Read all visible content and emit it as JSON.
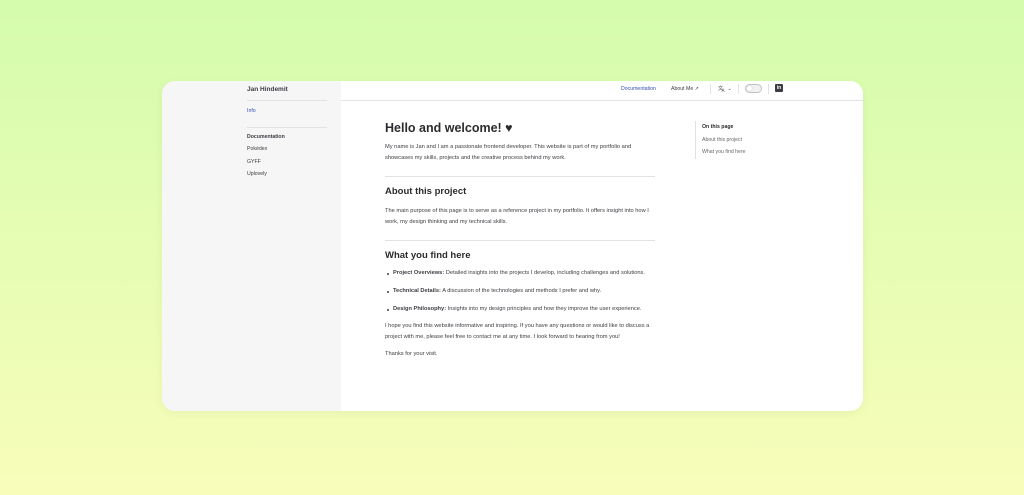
{
  "site": {
    "title": "Jan Hindemit"
  },
  "sidebar": {
    "top_link": "Info",
    "section_heading": "Documentation",
    "items": [
      "Pokédex",
      "GYFF",
      "Uplovely"
    ]
  },
  "nav": {
    "documentation": "Documentation",
    "about": "About Me ↗",
    "language_icon": "translate-icon",
    "chevron": "⌄",
    "social": "in"
  },
  "main": {
    "title": "Hello and welcome! ♥",
    "intro": "My name is Jan and I am a passionate frontend developer. This website is part of my portfolio and showcases my skills, projects and the creative process behind my work.",
    "about_heading": "About this project",
    "about_text": "The main purpose of this page is to serve as a reference project in my portfolio. It offers insight into how I work, my design thinking and my technical skills.",
    "find_heading": "What you find here",
    "bullets": [
      {
        "label": "Project Overviews:",
        "text": " Detailed insights into the projects I develop, including challenges and solutions."
      },
      {
        "label": "Technical Details:",
        "text": " A discussion of the technologies and methods I prefer and why."
      },
      {
        "label": "Design Philosophy:",
        "text": " Insights into my design principles and how they improve the user experience."
      }
    ],
    "closing": "I hope you find this website informative and inspiring. If you have any questions or would like to discuss a project with me, please feel free to contact me at any time. I look forward to hearing from you!",
    "thanks": "Thanks for your visit."
  },
  "toc": {
    "title": "On this page",
    "items": [
      "About this project",
      "What you find here"
    ]
  },
  "colors": {
    "brand": "#3451b2",
    "text": "#3c3c43",
    "sidebar_bg": "#f6f6f7"
  }
}
